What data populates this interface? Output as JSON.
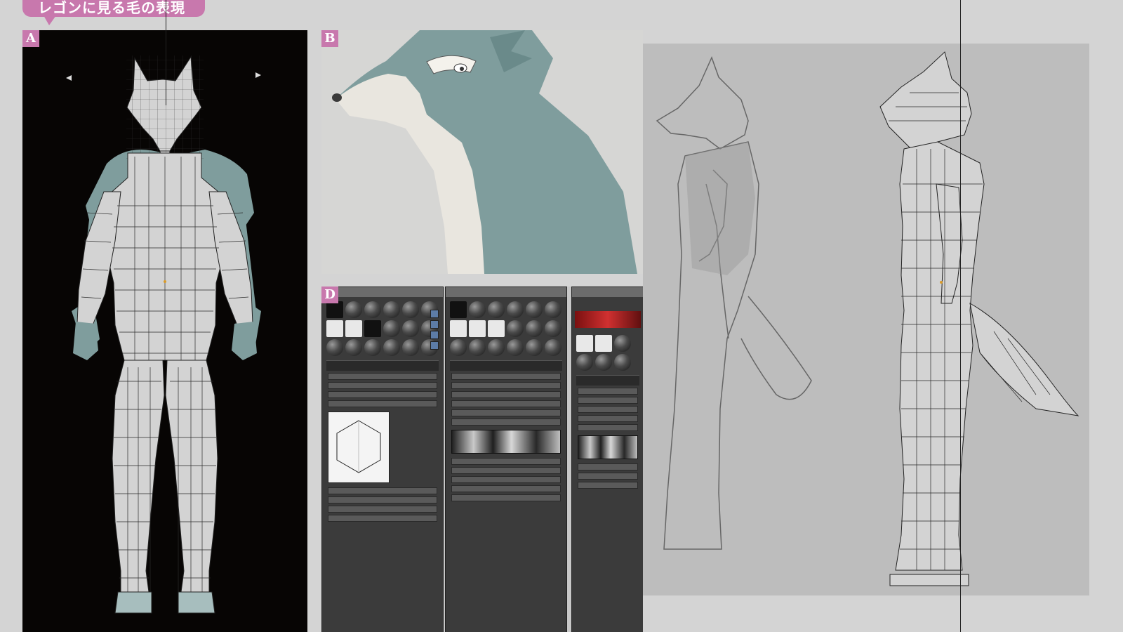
{
  "header": {
    "title": "レゴンに見る毛の表現"
  },
  "panels": {
    "a": {
      "letter": "A"
    },
    "b": {
      "letter": "B"
    },
    "d": {
      "letter": "D"
    }
  },
  "colors": {
    "accent": "#c878ad",
    "mesh_fill": "#d3d3d3",
    "fur_teal": "#7f9d9d",
    "viewport_bg": "#070504",
    "ref_bg": "#bdbdbd"
  },
  "editor_windows": [
    {
      "id": "material-editor-1"
    },
    {
      "id": "material-editor-2"
    },
    {
      "id": "material-editor-3"
    }
  ]
}
